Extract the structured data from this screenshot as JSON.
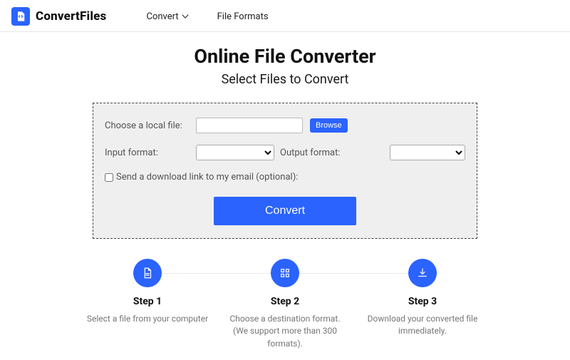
{
  "header": {
    "brand": "ConvertFiles",
    "nav": {
      "convert": "Convert",
      "formats": "File Formats"
    }
  },
  "main": {
    "title": "Online File Converter",
    "subtitle": "Select Files to Convert"
  },
  "panel": {
    "choose_label": "Choose a local file:",
    "browse": "Browse",
    "input_format_label": "Input format:",
    "output_format_label": "Output format:",
    "email_label": "Send a download link to my email (optional):",
    "convert": "Convert"
  },
  "steps": [
    {
      "title": "Step 1",
      "desc": "Select a file from your computer"
    },
    {
      "title": "Step 2",
      "desc": "Choose a destination format. (We support more than 300 formats)."
    },
    {
      "title": "Step 3",
      "desc": "Download your converted file immediately."
    }
  ]
}
